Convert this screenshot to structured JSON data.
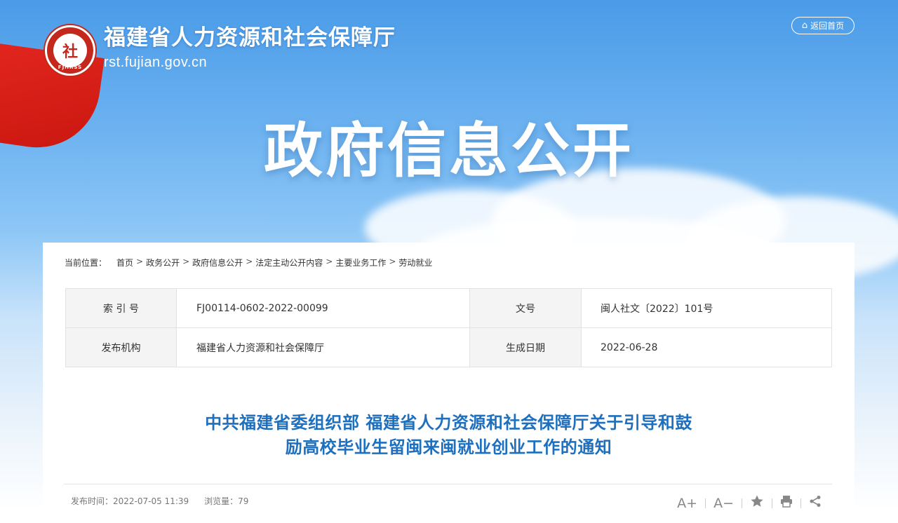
{
  "header": {
    "site_title": "福建省人力资源和社会保障厅",
    "site_domain": "rst.fujian.gov.cn",
    "emblem_char": "社",
    "emblem_ring": "FJHRSS",
    "home_button": "返回首页",
    "home_icon": "home-icon"
  },
  "hero": {
    "title": "政府信息公开"
  },
  "breadcrumb": {
    "label": "当前位置：",
    "items": [
      "首页",
      "政务公开",
      "政府信息公开",
      "法定主动公开内容",
      "主要业务工作",
      "劳动就业"
    ],
    "separator": ">"
  },
  "meta": {
    "index_label": "索 引 号",
    "index_value": "FJ00114-0602-2022-00099",
    "doc_no_label": "文号",
    "doc_no_value": "闽人社文〔2022〕101号",
    "publisher_label": "发布机构",
    "publisher_value": "福建省人力资源和社会保障厅",
    "date_label": "生成日期",
    "date_value": "2022-06-28"
  },
  "article": {
    "title_line1": "中共福建省委组织部 福建省人力资源和社会保障厅关于引导和鼓",
    "title_line2": "励高校毕业生留闽来闽就业创业工作的通知",
    "publish_time": "发布时间：2022-07-05 11:39",
    "views": "浏览量：79"
  },
  "tools": {
    "font_up": "A+",
    "font_down": "A−",
    "favorite_icon": "star-icon",
    "print_icon": "print-icon",
    "share_icon": "share-icon"
  },
  "colors": {
    "title_blue": "#1e6fbd",
    "emblem_red": "#c4281c"
  }
}
